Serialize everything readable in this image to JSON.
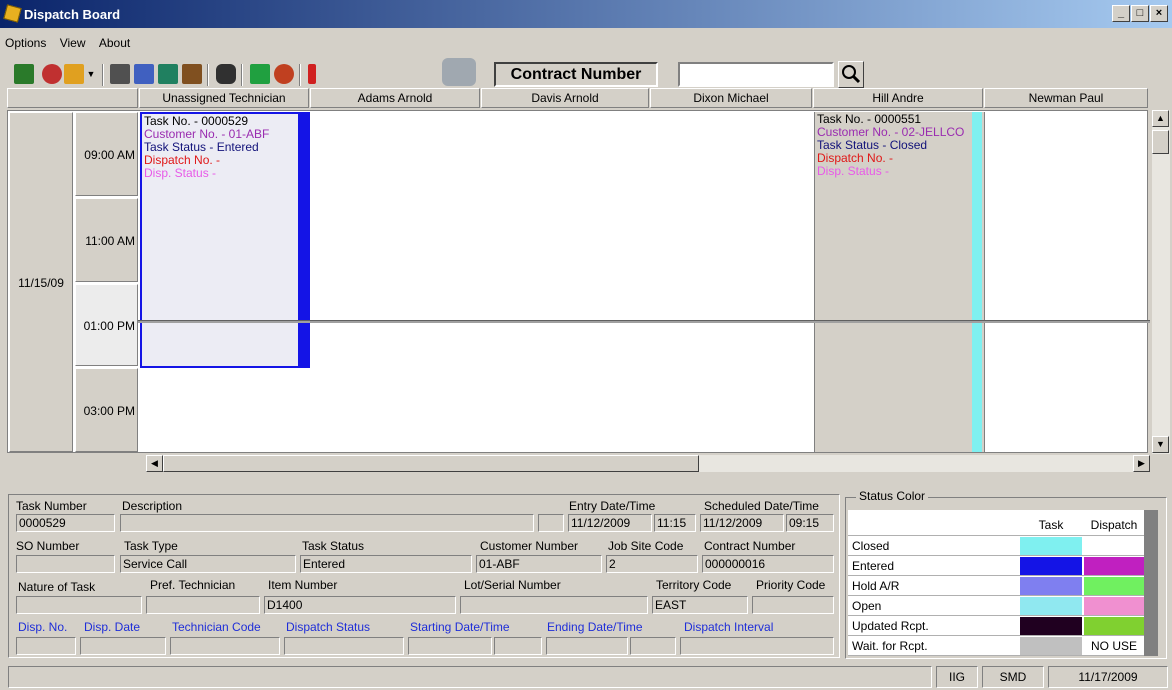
{
  "window": {
    "title": "Dispatch Board"
  },
  "menu": [
    "Options",
    "View",
    "About"
  ],
  "toolbar": {
    "search_label": "Contract Number",
    "search_value": "",
    "icons": [
      "calendar-icon",
      "refresh-icon",
      "technician-icon",
      "dropdown-arrow-icon",
      "grid-icon",
      "edit-icon",
      "route-icon",
      "person-icon",
      "binoculars-icon",
      "report-icon",
      "zoom-icon",
      "alert-icon",
      "printer-icon",
      "magnifier-icon"
    ]
  },
  "columns": [
    "Unassigned Technician",
    "Adams Arnold",
    "Davis Arnold",
    "Dixon Michael",
    "Hill Andre",
    "Newman Paul"
  ],
  "schedule": {
    "date": "11/15/09",
    "times": [
      "09:00 AM",
      "11:00 AM",
      "01:00 PM",
      "03:00 PM"
    ],
    "tasks": [
      {
        "task_no": "Task No. - 0000529",
        "customer": "Customer No. - 01-ABF",
        "status": "Task Status - Entered",
        "dispatch": "Dispatch No. -",
        "disp_status": "Disp. Status -",
        "bar_color": "#1414e6"
      },
      {
        "task_no": "Task No. - 0000551",
        "customer": "Customer No. - 02-JELLCO",
        "status": "Task Status - Closed",
        "dispatch": "Dispatch No. -",
        "disp_status": "Disp. Status -",
        "bar_color": "#7ff0f0"
      }
    ]
  },
  "details": {
    "task_number_label": "Task Number",
    "task_number": "0000529",
    "description_label": "Description",
    "description": "",
    "entry_label": "Entry Date/Time",
    "entry_date": "11/12/2009",
    "entry_time": "11:15",
    "sched_label": "Scheduled Date/Time",
    "sched_date": "11/12/2009",
    "sched_time": "09:15",
    "so_label": "SO Number",
    "so": "",
    "type_label": "Task Type",
    "type": "Service Call",
    "status_label": "Task Status",
    "status": "Entered",
    "cust_label": "Customer Number",
    "cust": "01-ABF",
    "jobsite_label": "Job Site Code",
    "jobsite": "2",
    "contract_label": "Contract Number",
    "contract": "000000016",
    "nature_label": "Nature of Task",
    "nature": "",
    "pref_label": "Pref. Technician",
    "pref": "",
    "item_label": "Item Number",
    "item": "D1400",
    "lot_label": "Lot/Serial Number",
    "lot": "",
    "territory_label": "Territory Code",
    "territory": "EAST",
    "priority_label": "Priority Code",
    "priority": "",
    "disp_no_label": "Disp. No.",
    "disp_date_label": "Disp. Date",
    "tech_label": "Technician Code",
    "disp_status_label": "Dispatch Status",
    "start_label": "Starting Date/Time",
    "end_label": "Ending Date/Time",
    "interval_label": "Dispatch Interval"
  },
  "legend": {
    "title": "Status Color",
    "task_header": "Task",
    "dispatch_header": "Dispatch",
    "rows": [
      {
        "name": "Closed",
        "task": "#7ff0f0",
        "dispatch": "#ffffff",
        "text": ""
      },
      {
        "name": "Entered",
        "task": "#1414e6",
        "dispatch": "#c020c0",
        "text": ""
      },
      {
        "name": "Hold A/R",
        "task": "#7f7ff0",
        "dispatch": "#70f060",
        "text": ""
      },
      {
        "name": "Open",
        "task": "#90e8f0",
        "dispatch": "#f090d0",
        "text": ""
      },
      {
        "name": "Updated Rcpt.",
        "task": "#200020",
        "dispatch": "#80d030",
        "text": ""
      },
      {
        "name": "Wait. for Rcpt.",
        "task": "#c0c0c0",
        "dispatch": "#ffffff",
        "text": "NO USE"
      }
    ]
  },
  "statusbar": {
    "p1": "IIG",
    "p2": "SMD",
    "p3": "11/17/2009"
  }
}
